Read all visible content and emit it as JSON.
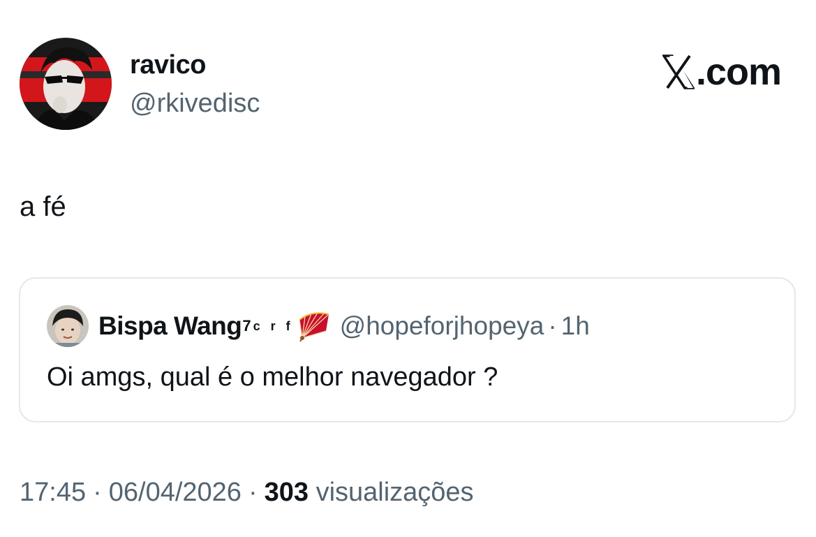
{
  "author": {
    "display_name": "ravico",
    "handle": "@rkivedisc",
    "avatar_icon": "profile-photo-icon"
  },
  "brand": {
    "logo_icon": "x-logo-icon",
    "label": ".com"
  },
  "tweet": {
    "text": "a fé"
  },
  "quote": {
    "avatar_icon": "profile-photo-icon",
    "display_name": "Bispa Wang",
    "name_superscript": "7",
    "name_letters": "c r f",
    "emoji_icon": "folding-fan-icon",
    "handle": "@hopeforjhopeya",
    "separator": "·",
    "time": "1h",
    "text": "Oi amgs, qual é o melhor navegador ?"
  },
  "meta": {
    "time": "17:45",
    "date": "06/04/2026",
    "separator": "·",
    "views_count": "303",
    "views_label": "visualizações"
  },
  "colors": {
    "text_primary": "#0f1419",
    "text_secondary": "#536471",
    "card_border": "#e4e8ec",
    "avatar_red": "#d2161b",
    "fan_red": "#c8102e"
  }
}
